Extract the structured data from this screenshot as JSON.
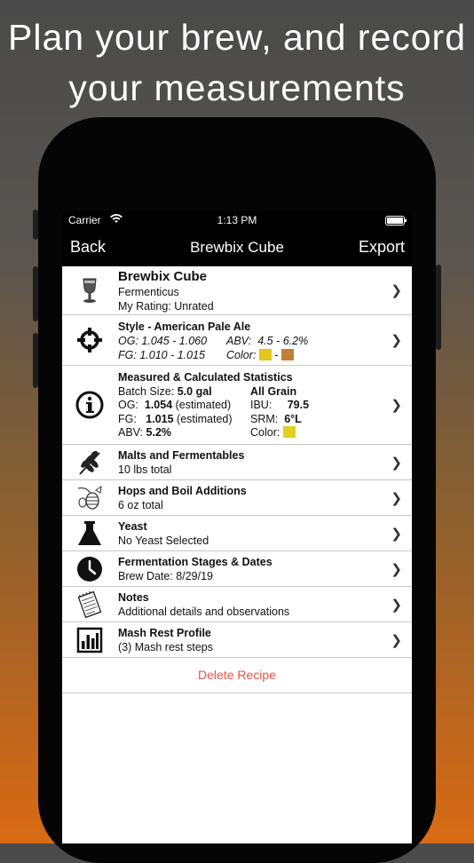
{
  "headline": {
    "line1": "Plan your brew, and record",
    "line2": "your measurements"
  },
  "status": {
    "carrier": "Carrier",
    "time": "1:13 PM"
  },
  "nav": {
    "back": "Back",
    "title": "Brewbix Cube",
    "export": "Export"
  },
  "recipe": {
    "name": "Brewbix Cube",
    "brewer": "Fermenticus",
    "rating": "My Rating:  Unrated"
  },
  "style": {
    "title": "Style - American Pale Ale",
    "og_label": "OG:",
    "og": "1.045 - 1.060",
    "abv_label": "ABV:",
    "abv": "4.5 - 6.2%",
    "fg_label": "FG:",
    "fg": "1.010 - 1.015",
    "color_label": "Color:",
    "color_dash": "-",
    "color_low": "#e3c51c",
    "color_high": "#c0803a"
  },
  "stats": {
    "title": "Measured & Calculated Statistics",
    "batch_label": "Batch Size:",
    "batch": "5.0 gal",
    "type": "All Grain",
    "og_label": "OG:",
    "og": "1.054",
    "og_note": "(estimated)",
    "ibu_label": "IBU:",
    "ibu": "79.5",
    "fg_label": "FG:",
    "fg": "1.015",
    "fg_note": "(estimated)",
    "srm_label": "SRM:",
    "srm": "6°L",
    "abv_label": "ABV:",
    "abv": "5.2%",
    "color_label": "Color:",
    "color": "#e3d01e"
  },
  "malts": {
    "title": "Malts and Fermentables",
    "sub": "10 lbs total"
  },
  "hops": {
    "title": "Hops and Boil Additions",
    "sub": "6 oz total"
  },
  "yeast": {
    "title": "Yeast",
    "sub": "No Yeast Selected"
  },
  "ferment": {
    "title": "Fermentation Stages & Dates",
    "sub": "Brew Date: 8/29/19"
  },
  "notes": {
    "title": "Notes",
    "sub": "Additional details and observations"
  },
  "mash": {
    "title": "Mash Rest Profile",
    "sub": "(3) Mash rest steps"
  },
  "chevron": "❯",
  "delete_label": "Delete Recipe"
}
